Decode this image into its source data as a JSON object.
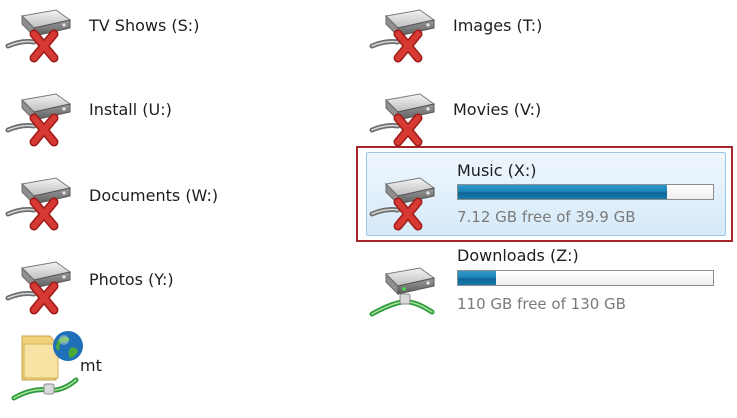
{
  "drives": [
    {
      "label": "TV Shows (S:)",
      "status": "disconnected",
      "icon": "disconnected-network-drive-icon"
    },
    {
      "label": "Images (T:)",
      "status": "disconnected",
      "icon": "disconnected-network-drive-icon"
    },
    {
      "label": "Install (U:)",
      "status": "disconnected",
      "icon": "disconnected-network-drive-icon"
    },
    {
      "label": "Movies (V:)",
      "status": "disconnected",
      "icon": "disconnected-network-drive-icon"
    },
    {
      "label": "Documents (W:)",
      "status": "disconnected",
      "icon": "disconnected-network-drive-icon"
    },
    {
      "label": "Music (X:)",
      "status": "disconnected",
      "icon": "disconnected-network-drive-icon",
      "selected": true,
      "used_fraction": 0.82,
      "free_text": "7.12 GB free of 39.9 GB"
    },
    {
      "label": "Photos (Y:)",
      "status": "disconnected",
      "icon": "disconnected-network-drive-icon"
    },
    {
      "label": "Downloads (Z:)",
      "status": "connected",
      "icon": "network-drive-icon",
      "used_fraction": 0.15,
      "free_text": "110 GB free of 130 GB"
    },
    {
      "label": "mt",
      "status": "network-location",
      "icon": "network-folder-icon"
    }
  ],
  "colors": {
    "bar_fill": "#1e84b8",
    "selection_background": "#d6eaf9",
    "selection_border": "#9ec8ea",
    "highlight_frame": "#a8262b",
    "error_cross": "#d63a32",
    "network_cable": "#2f9a3d"
  }
}
